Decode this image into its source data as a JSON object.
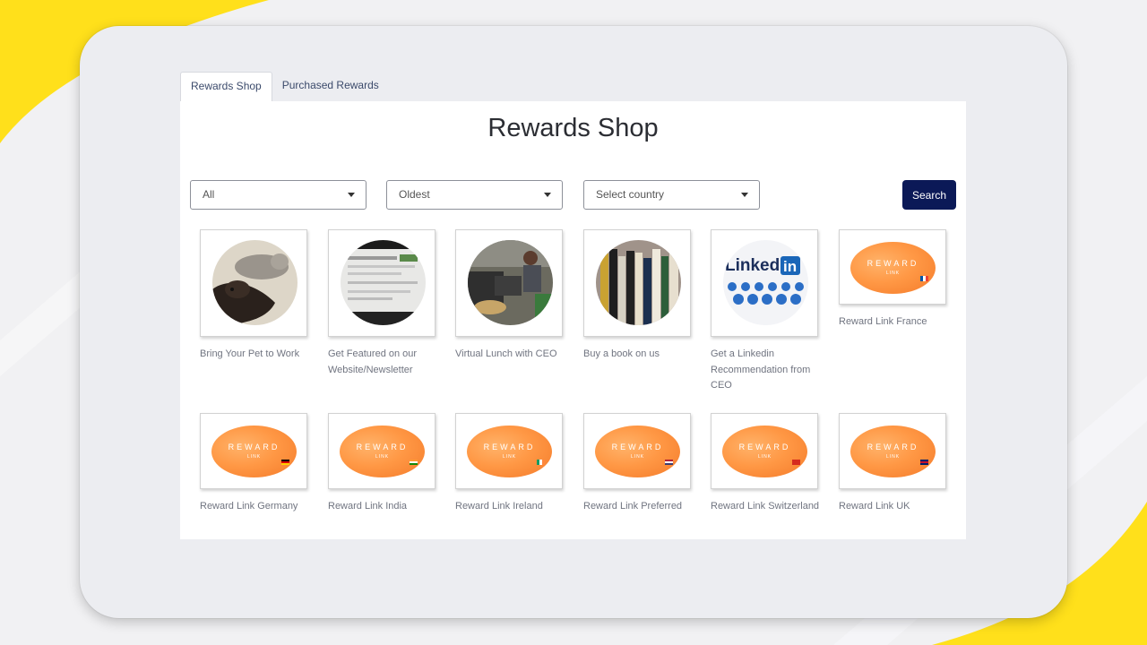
{
  "tabs": [
    {
      "label": "Rewards Shop",
      "active": true
    },
    {
      "label": "Purchased Rewards",
      "active": false
    }
  ],
  "page_title": "Rewards Shop",
  "filters": {
    "category": "All",
    "sort": "Oldest",
    "country_placeholder": "Select country",
    "search_label": "Search"
  },
  "rewards": [
    {
      "name": "Bring Your Pet to Work",
      "image": "pet-photo"
    },
    {
      "name": "Get Featured on our Website/Newsletter",
      "image": "website-photo"
    },
    {
      "name": "Virtual Lunch with CEO",
      "image": "lunch-photo"
    },
    {
      "name": "Buy a book on us",
      "image": "books-photo"
    },
    {
      "name": "Get a Linkedin Recommendation from CEO",
      "image": "linkedin-logo"
    },
    {
      "name": "Reward Link France",
      "image": "reward-link-card",
      "flag": "france"
    },
    {
      "name": "Reward Link Germany",
      "image": "reward-link-card",
      "flag": "germany"
    },
    {
      "name": "Reward Link India",
      "image": "reward-link-card",
      "flag": "india"
    },
    {
      "name": "Reward Link Ireland",
      "image": "reward-link-card",
      "flag": "ireland"
    },
    {
      "name": "Reward Link Preferred",
      "image": "reward-link-card",
      "flag": "usa"
    },
    {
      "name": "Reward Link Switzerland",
      "image": "reward-link-card",
      "flag": "switzerland"
    },
    {
      "name": "Reward Link UK",
      "image": "reward-link-card",
      "flag": "uk"
    }
  ],
  "reward_card_text": {
    "word": "REWARD",
    "sub": "LINK"
  },
  "linkedin_logo": "Linked",
  "linkedin_in": "in",
  "colors": {
    "accent_yellow": "#ffe01b",
    "search_button": "#0b1957",
    "reward_orange": "#ff9845"
  }
}
